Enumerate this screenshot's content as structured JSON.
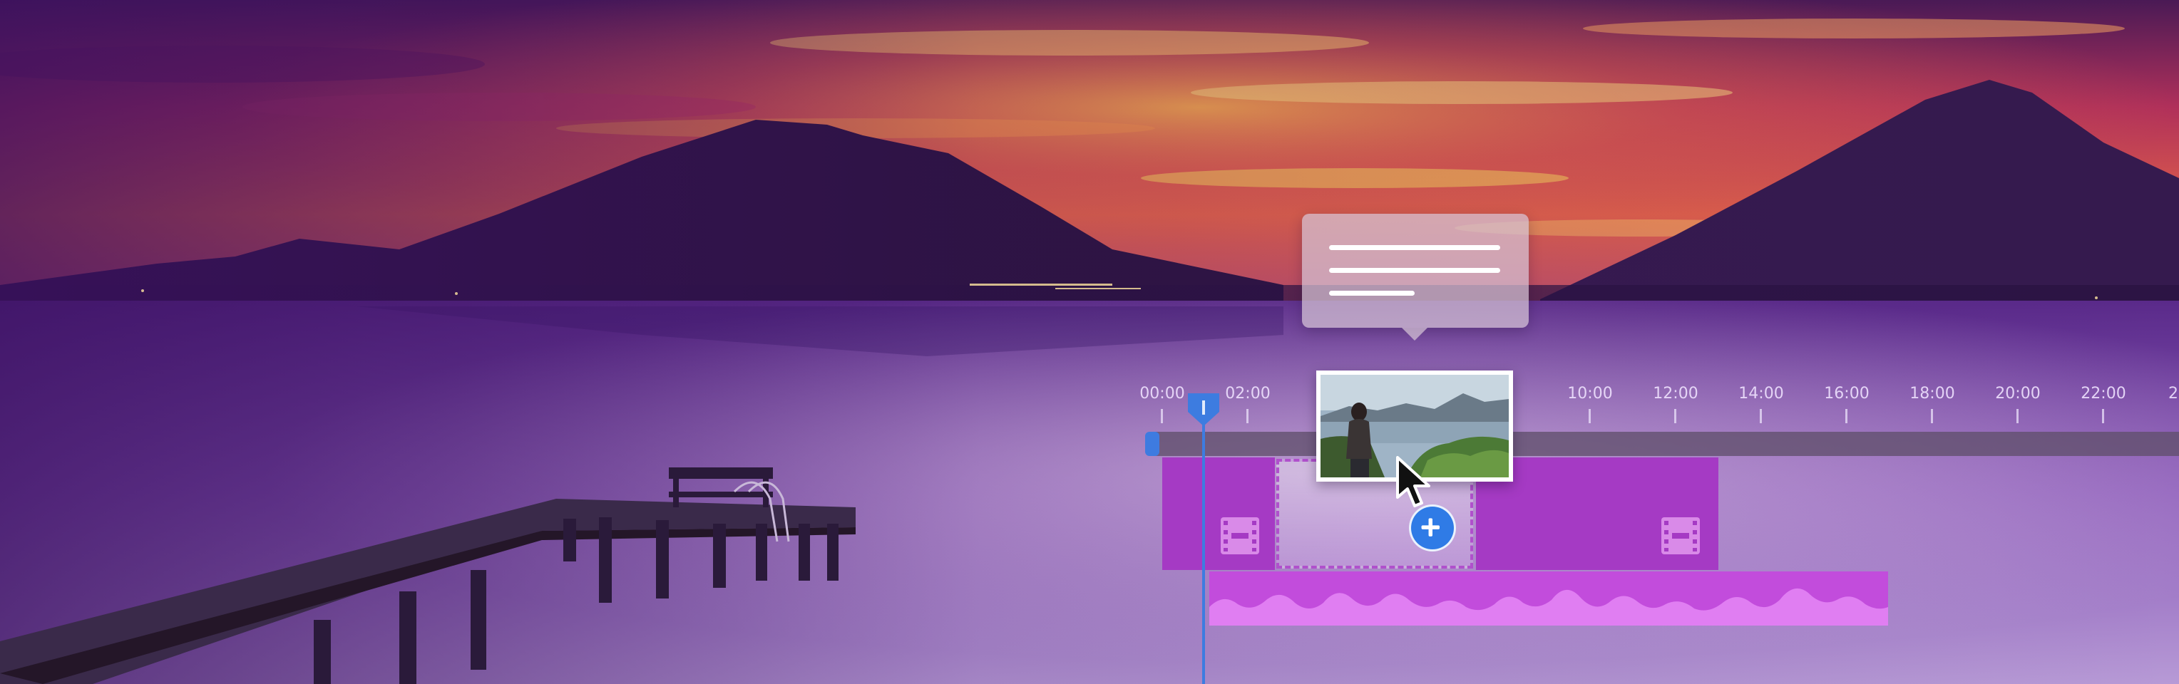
{
  "colors": {
    "accent": "#3d7ce0",
    "clip": "#a53ac4",
    "audio_clip": "#c24cdc",
    "drop_zone_border": "#b050cc"
  },
  "timeline": {
    "tick_labels": [
      "00:00",
      "02:00",
      "10:00",
      "12:00",
      "14:00",
      "16:00",
      "18:00",
      "20:00",
      "22:00",
      "2"
    ]
  },
  "icons": {
    "tooltip": "text-lines-icon",
    "clip": "film-strip-icon",
    "add": "plus-icon",
    "cursor": "mouse-pointer-icon",
    "playhead": "playhead-icon"
  }
}
